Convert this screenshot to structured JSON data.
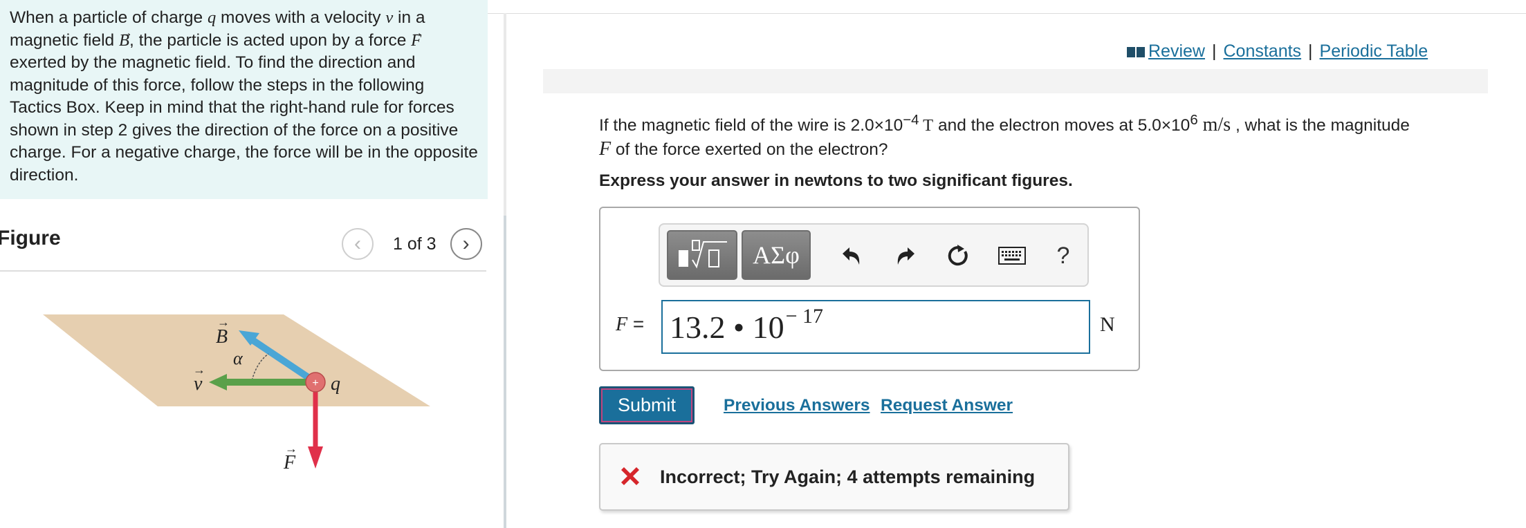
{
  "intro": {
    "p1": "When a particle of charge ",
    "var_q": "q",
    "p2": " moves with a velocity ",
    "var_v": "v",
    "p3": " in a magnetic field ",
    "var_B": "B",
    "p4": ", the particle is acted upon by a force ",
    "var_F": "F",
    "p5": " exerted by the magnetic field. To find the direction and magnitude of this force, follow the steps in the following Tactics Box. Keep in mind that the right-hand rule for forces shown in step 2 gives the direction of the force on a positive charge. For a negative charge, the force will be in the opposite direction."
  },
  "figure": {
    "title": "Figure",
    "counter": "1 of 3",
    "prev_glyph": "‹",
    "next_glyph": "›",
    "labels": {
      "B": "B",
      "alpha": "α",
      "v": "v",
      "q": "q",
      "F": "F"
    },
    "colors": {
      "plane": "#e6cfb0",
      "field": "#4aa6d6",
      "velocity": "#5aa04a",
      "force": "#e0304a",
      "charge": "#e07070"
    }
  },
  "links": {
    "review": "Review",
    "constants": "Constants",
    "periodic_table": "Periodic Table",
    "separator": "|"
  },
  "question": {
    "p1": "If the magnetic field of the wire is 2.0×10",
    "exp1": "−4",
    "unit1": " T",
    "p2": " and the electron moves at 5.0×10",
    "exp2": "6",
    "unit2": " m/s",
    "p3": " , what is the magnitude ",
    "var": "F",
    "p4": " of the force exerted on the electron?",
    "instruction": "Express your answer in newtons to two significant figures."
  },
  "toolbar": {
    "symbols_label": "ΑΣφ",
    "help_label": "?",
    "icons": [
      "templates-icon",
      "greek-symbols-icon",
      "undo-icon",
      "redo-icon",
      "reset-icon",
      "keyboard-icon",
      "help-icon"
    ]
  },
  "answer": {
    "variable": "F",
    "equals": " =",
    "mantissa": "13.2 • 10",
    "exponent": "− 17",
    "unit": "N"
  },
  "actions": {
    "submit": "Submit",
    "previous_answers": "Previous Answers",
    "request_answer": "Request Answer"
  },
  "feedback": {
    "text": "Incorrect; Try Again; 4 attempts remaining",
    "icon_color": "#d6262b"
  },
  "theme": {
    "accent": "#1a6f9b",
    "intro_bg": "#e8f6f6"
  }
}
